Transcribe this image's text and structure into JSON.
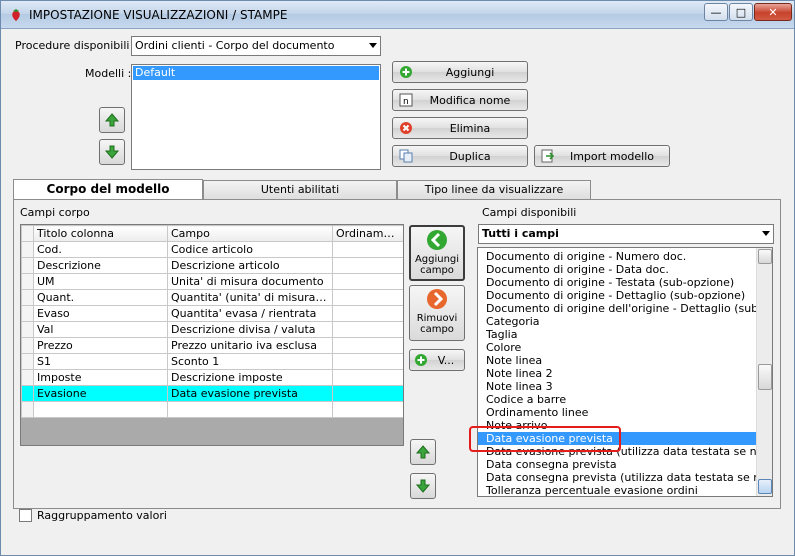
{
  "window": {
    "title": "IMPOSTAZIONE VISUALIZZAZIONI / STAMPE"
  },
  "procedure": {
    "label": "Procedure disponibili :",
    "value": "Ordini clienti - Corpo del documento"
  },
  "modelli": {
    "label": "Modelli :",
    "items": [
      "Default"
    ]
  },
  "buttons": {
    "aggiungi": "Aggiungi",
    "modifica_nome": "Modifica nome",
    "elimina": "Elimina",
    "duplica": "Duplica",
    "import_modello": "Import modello"
  },
  "tabs": [
    "Corpo del modello",
    "Utenti abilitati",
    "Tipo linee da visualizzare"
  ],
  "campi_corpo": {
    "label": "Campi corpo",
    "columns": [
      "Titolo colonna",
      "Campo",
      "Ordinamento"
    ],
    "rows": [
      [
        "Cod.",
        "Codice articolo",
        ""
      ],
      [
        "Descrizione",
        "Descrizione articolo",
        ""
      ],
      [
        "UM",
        "Unita' di misura documento",
        ""
      ],
      [
        "Quant.",
        "Quantita' (unita' di misura docum...",
        ""
      ],
      [
        "Evaso",
        "Quantita' evasa / rientrata",
        ""
      ],
      [
        "Val",
        "Descrizione divisa / valuta",
        ""
      ],
      [
        "Prezzo",
        "Prezzo unitario iva esclusa",
        ""
      ],
      [
        "S1",
        "Sconto 1",
        ""
      ],
      [
        "Imposte",
        "Descrizione imposte",
        ""
      ],
      [
        "Evasione",
        "Data evasione prevista",
        ""
      ],
      [
        "",
        "",
        ""
      ]
    ],
    "selected_row": 9
  },
  "middle_buttons": {
    "aggiungi_campo": [
      "Aggiungi",
      "campo"
    ],
    "rimuovi_campo": [
      "Rimuovi",
      "campo"
    ],
    "v": "V..."
  },
  "campi_disponibili": {
    "label": "Campi disponibili",
    "filter": "Tutti i campi",
    "items": [
      "Documento di origine - Numero doc.",
      "Documento di origine - Data doc.",
      "Documento di origine - Testata (sub-opzione)",
      "Documento di origine - Dettaglio (sub-opzione)",
      "Documento di origine dell'origine - Dettaglio (sub-opzione)",
      "Categoria",
      "Taglia",
      "Colore",
      "Note linea",
      "Note linea 2",
      "Note linea 3",
      "Codice a barre",
      "Ordinamento linee",
      "Note arrivo",
      "Data evasione prevista",
      "Data evasione prevista (utilizza data testata se non specif",
      "Data consegna prevista",
      "Data consegna prevista (utilizza data testata se non speci",
      "Tolleranza percentuale evasione ordini"
    ],
    "selected_index": 14
  },
  "raggruppamento": {
    "label": "Raggruppamento valori",
    "checked": false
  },
  "colors": {
    "selection": "#3399ff",
    "row_highlight": "#00ffff",
    "annotation": "#e51c1c"
  }
}
